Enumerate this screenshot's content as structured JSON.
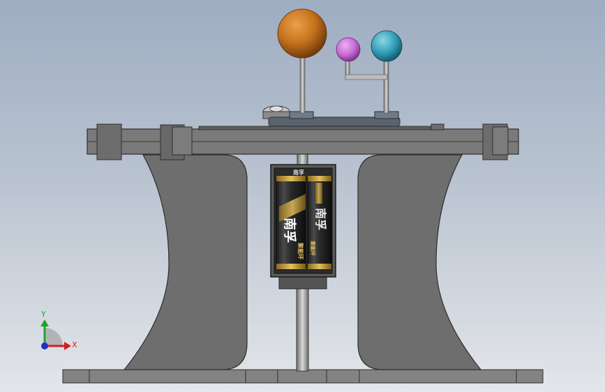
{
  "view": {
    "background_top": "#9eadc2",
    "background_bottom": "#e3e6ea",
    "part_fill": "#6e6e6e",
    "part_stroke": "#2e2e2e"
  },
  "model": {
    "spheres": [
      {
        "id": "sun",
        "color": "#c4711c"
      },
      {
        "id": "moon",
        "color": "#c46ad2"
      },
      {
        "id": "earth",
        "color": "#2f9db5"
      }
    ],
    "battery": {
      "brand_label_left": "南孚",
      "brand_label_right": "南孚",
      "small_text_left": "聚能环",
      "small_text_right": "聚能环",
      "top_label": "南孚"
    }
  },
  "triad": {
    "x_label": "X",
    "y_label": "Y",
    "x_color": "#d22020",
    "y_color": "#21a32a",
    "z_color": "#2030c8"
  }
}
